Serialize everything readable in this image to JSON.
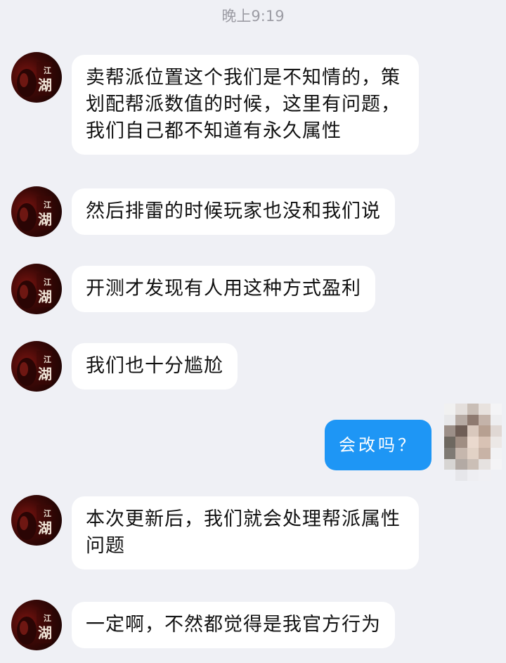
{
  "timestamp": "晚上9:19",
  "avatar_badge_text": "江湖",
  "messages": [
    {
      "direction": "incoming",
      "text": "卖帮派位置这个我们是不知情的，策划配帮派数值的时候，这里有问题，我们自己都不知道有永久属性"
    },
    {
      "direction": "incoming",
      "text": "然后排雷的时候玩家也没和我们说"
    },
    {
      "direction": "incoming",
      "text": "开测才发现有人用这种方式盈利"
    },
    {
      "direction": "incoming",
      "text": "我们也十分尴尬"
    },
    {
      "direction": "outgoing",
      "text": "会改吗？"
    },
    {
      "direction": "incoming",
      "text": "本次更新后，我们就会处理帮派属性问题"
    },
    {
      "direction": "incoming",
      "text": "一定啊，不然都觉得是我官方行为"
    }
  ],
  "colors": {
    "background": "#eff0f5",
    "incoming_bubble": "#ffffff",
    "outgoing_bubble": "#1e96f5",
    "timestamp_text": "#9c9ca4"
  }
}
